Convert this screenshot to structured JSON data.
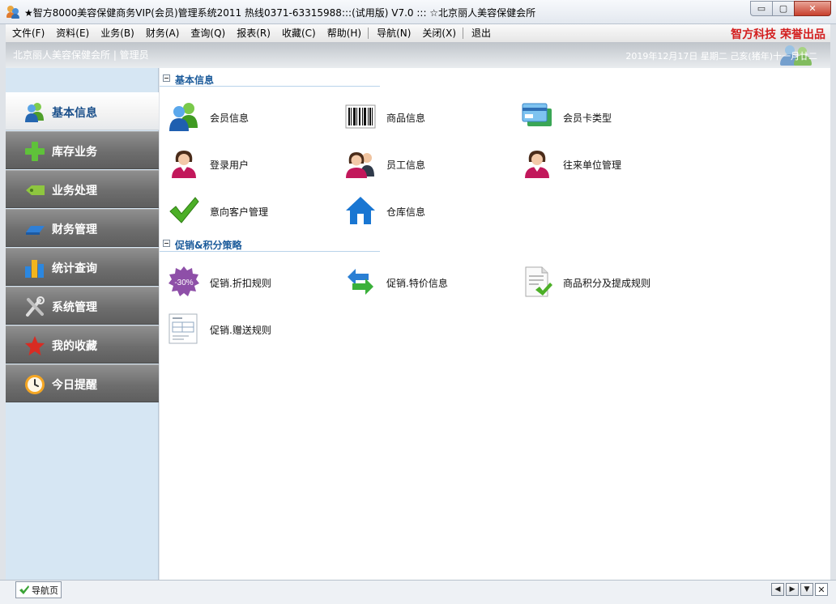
{
  "window": {
    "title": "★智方8000美容保健商务VIP(会员)管理系统2011 热线0371-63315988:::(试用版) V7.0 ::: ☆北京丽人美容保健会所",
    "min_glyph": "▭",
    "max_glyph": "▢",
    "close_glyph": "✕"
  },
  "menu": {
    "items": [
      "文件(F)",
      "资料(E)",
      "业务(B)",
      "财务(A)",
      "查询(Q)",
      "报表(R)",
      "收藏(C)",
      "帮助(H)",
      "导航(N)",
      "关闭(X)",
      "退出"
    ],
    "brand": "智方科技 荣誉出品"
  },
  "info": {
    "org": "北京丽人美容保健会所 | 管理员",
    "date": "2019年12月17日  星期二  己亥(猪年)十一月廿二"
  },
  "sidebar": {
    "items": [
      {
        "label": "基本信息",
        "icon": "users-icon"
      },
      {
        "label": "库存业务",
        "icon": "plus-icon"
      },
      {
        "label": "业务处理",
        "icon": "tag-icon"
      },
      {
        "label": "财务管理",
        "icon": "eraser-icon"
      },
      {
        "label": "统计查询",
        "icon": "bar-chart-icon"
      },
      {
        "label": "系统管理",
        "icon": "tools-icon"
      },
      {
        "label": "我的收藏",
        "icon": "star-icon"
      },
      {
        "label": "今日提醒",
        "icon": "clock-icon"
      }
    ]
  },
  "main": {
    "sections": [
      {
        "title": "基本信息",
        "tiles": [
          {
            "label": "会员信息",
            "icon": "members-icon"
          },
          {
            "label": "商品信息",
            "icon": "barcode-icon"
          },
          {
            "label": "会员卡类型",
            "icon": "card-icon"
          },
          {
            "label": "登录用户",
            "icon": "user-female-icon"
          },
          {
            "label": "员工信息",
            "icon": "staff-icon"
          },
          {
            "label": "往来单位管理",
            "icon": "partner-icon"
          },
          {
            "label": "意向客户管理",
            "icon": "checkmark-icon"
          },
          {
            "label": "仓库信息",
            "icon": "house-icon"
          }
        ]
      },
      {
        "title": "促销&积分策略",
        "tiles": [
          {
            "label": "促销.折扣规则",
            "icon": "discount-badge-icon",
            "badge_text": "-30%"
          },
          {
            "label": "促销.特价信息",
            "icon": "exchange-arrows-icon"
          },
          {
            "label": "商品积分及提成规则",
            "icon": "document-check-icon"
          },
          {
            "label": "促销.赠送规则",
            "icon": "form-document-icon"
          }
        ]
      }
    ]
  },
  "status": {
    "tab_label": "导航页",
    "nav_buttons": [
      "◀",
      "▶",
      "▼",
      "✕"
    ]
  },
  "colors": {
    "accent": "#1a5a9a",
    "brand": "#d31f1f",
    "sidebar_bg": "#d6e6f3"
  }
}
